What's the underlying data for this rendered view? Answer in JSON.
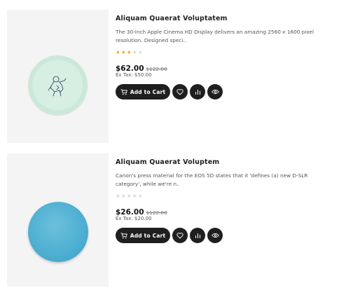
{
  "products": [
    {
      "title": "Aliquam Quaerat Voluptatem",
      "description": "The 30-inch Apple Cinema HD Display delivers an amazing 2560 x 1600 pixel resolution. Designed speci..",
      "rating": 3,
      "rating_max": 5,
      "price": "$62.00",
      "old_price": "$122.00",
      "tax": "Ex Tax: $50.00",
      "add_to_cart_label": "Add to Cart",
      "image": "mint-green-plate-with-sketch",
      "icons": [
        "cart-icon",
        "heart-icon",
        "compare-icon",
        "eye-icon"
      ]
    },
    {
      "title": "Aliquam Quaerat Voluptem",
      "description": "Canon's press material for the EOS 5D states that it 'defines (a) new D-SLR category', while we're n..",
      "rating": 0,
      "rating_max": 5,
      "price": "$26.00",
      "old_price": "$122.00",
      "tax": "Ex Tax: $20.00",
      "add_to_cart_label": "Add to Cart",
      "image": "blue-plate",
      "icons": [
        "cart-icon",
        "heart-icon",
        "compare-icon",
        "eye-icon"
      ]
    }
  ],
  "colors": {
    "star_on": "#f5a623",
    "star_off": "#d7d7d7",
    "button_bg": "#1f1f1f",
    "thumb_bg": "#f4f4f4"
  }
}
